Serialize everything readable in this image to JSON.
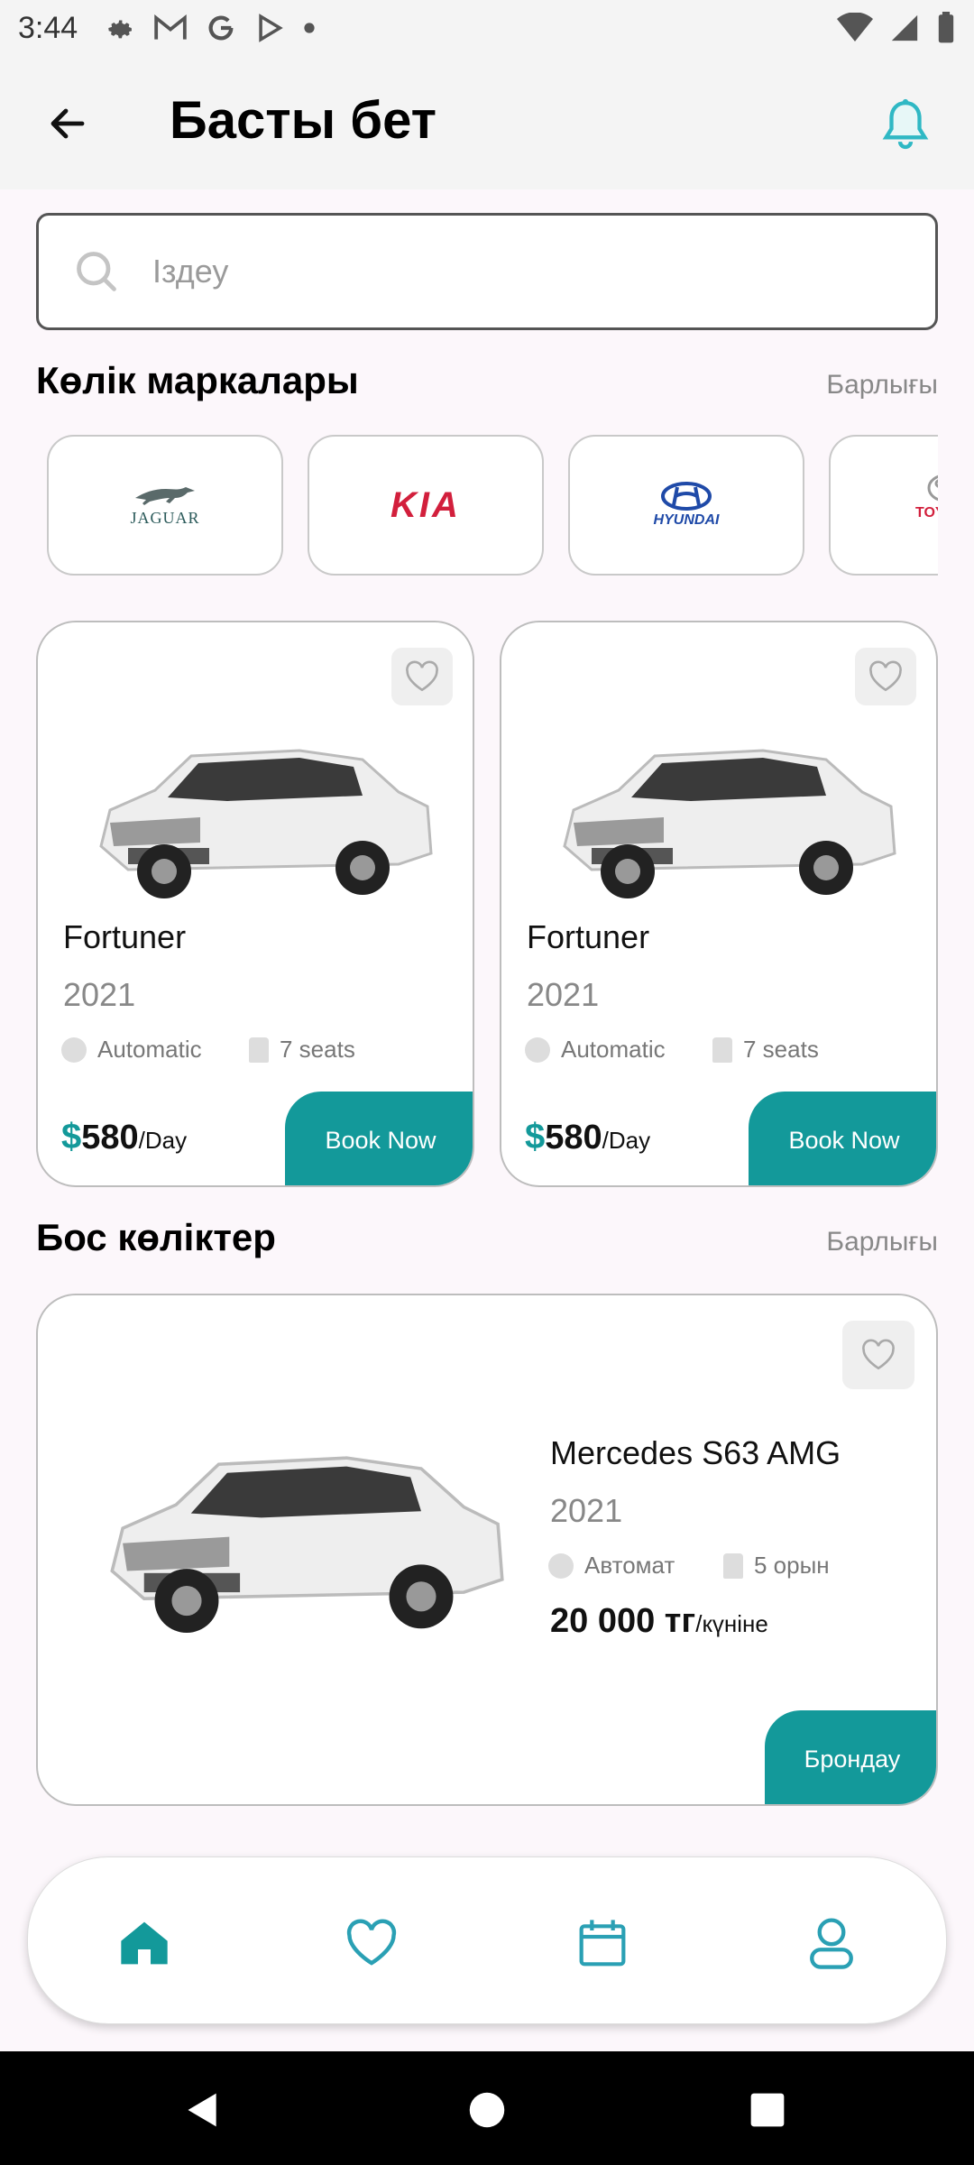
{
  "status_bar": {
    "time": "3:44",
    "icons": [
      "gear-icon",
      "gmail-icon",
      "google-icon",
      "play-icon",
      "dot-icon"
    ],
    "right_icons": [
      "wifi-icon",
      "signal-icon",
      "battery-icon"
    ]
  },
  "header": {
    "title": "Басты бет"
  },
  "search": {
    "placeholder": "Іздеу"
  },
  "brands_section": {
    "title": "Көлік маркалары",
    "see_all": "Барлығы",
    "brands": [
      "JAGUAR",
      "KIA",
      "HYUNDAI",
      "TOYOTA"
    ]
  },
  "popular_cars": [
    {
      "name": "Fortuner",
      "year": "2021",
      "transmission": "Automatic",
      "seats": "7 seats",
      "currency": "$",
      "price": "580",
      "period": "/Day",
      "button": "Book Now"
    },
    {
      "name": "Fortuner",
      "year": "2021",
      "transmission": "Automatic",
      "seats": "7 seats",
      "currency": "$",
      "price": "580",
      "period": "/Day",
      "button": "Book Now"
    }
  ],
  "available_section": {
    "title": "Бос көліктер",
    "see_all": "Барлығы"
  },
  "available_car": {
    "name": "Mercedes S63 AMG",
    "year": "2021",
    "transmission": "Автомат",
    "seats": "5 орын",
    "price": "20 000 тг",
    "period": "/күніне",
    "button": "Брондау"
  },
  "bottom_nav": [
    "home-icon",
    "heart-icon",
    "calendar-icon",
    "profile-icon"
  ],
  "colors": {
    "accent": "#13999a",
    "background": "#fcf7fb",
    "nav_active": "#13999a",
    "nav_inactive": "#2aa0b4"
  }
}
